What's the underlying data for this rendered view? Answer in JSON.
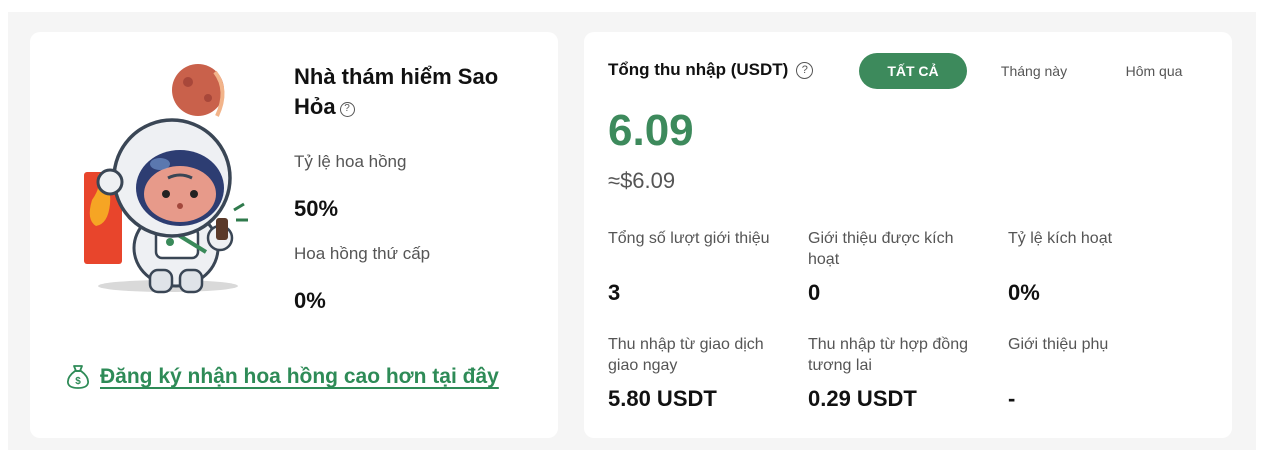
{
  "level": {
    "title": "Nhà thám hiểm Sao Hỏa",
    "help_glyph": "?",
    "commission_label": "Tỷ lệ hoa hồng",
    "commission_value": "50%",
    "secondary_label": "Hoa hồng thứ cấp",
    "secondary_value": "0%"
  },
  "promo": {
    "icon": "money-bag-icon",
    "link_text": "Đăng ký nhận hoa hồng cao hơn tại đây"
  },
  "earnings": {
    "title": "Tổng thu nhập (USDT)",
    "help_glyph": "?",
    "tabs": [
      {
        "label": "TẤT CẢ",
        "active": true
      },
      {
        "label": "Tháng này",
        "active": false
      },
      {
        "label": "Hôm qua",
        "active": false
      }
    ],
    "total": "6.09",
    "total_usd": "≈$6.09",
    "stats": [
      {
        "label": "Tổng số lượt giới thiệu",
        "value": "3"
      },
      {
        "label": "Giới thiệu được kích hoạt",
        "value": "0"
      },
      {
        "label": "Tỷ lệ kích hoạt",
        "value": "0%"
      },
      {
        "label": "Thu nhập từ giao dịch giao ngay",
        "value": "5.80 USDT"
      },
      {
        "label": "Thu nhập từ hợp đồng tương lai",
        "value": "0.29 USDT"
      },
      {
        "label": "Giới thiệu phụ",
        "value": "-"
      }
    ]
  },
  "colors": {
    "accent": "#3d8a5c",
    "link": "#2e8b57",
    "background": "#f5f5f5",
    "card": "#ffffff"
  }
}
